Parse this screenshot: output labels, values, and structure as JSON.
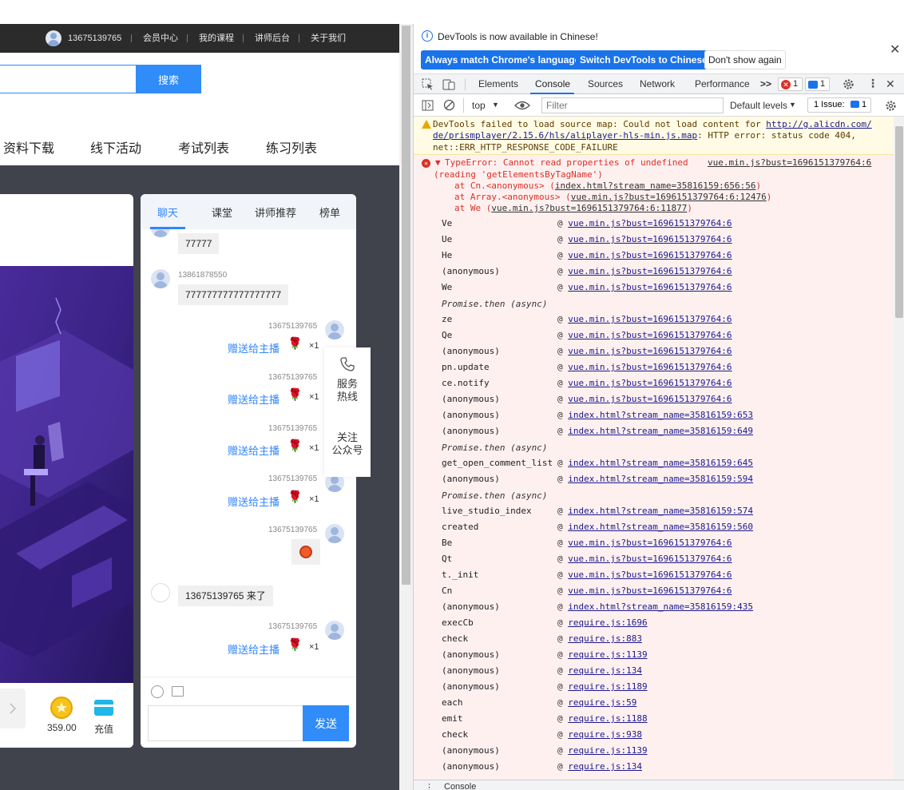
{
  "site": {
    "topbar": {
      "username": "13675139765",
      "links": [
        "会员中心",
        "我的课程",
        "讲师后台",
        "关于我们"
      ]
    },
    "search": {
      "placeholder": "",
      "button": "搜索"
    },
    "nav": [
      "资料下载",
      "线下活动",
      "考试列表",
      "练习列表"
    ],
    "player": {
      "coin_value": "359.00",
      "recharge": "充值"
    },
    "chat": {
      "tabs": [
        "聊天",
        "课堂",
        "讲师推荐",
        "榜单"
      ],
      "messages": [
        {
          "type": "text-left",
          "text": "77777"
        },
        {
          "type": "text-left",
          "user": "13861878550",
          "text": "777777777777777777"
        },
        {
          "type": "gift",
          "user": "13675139765",
          "gift": "赠送给主播",
          "count": "×1"
        },
        {
          "type": "gift",
          "user": "13675139765",
          "gift": "赠送给主播",
          "count": "×1"
        },
        {
          "type": "gift",
          "user": "13675139765",
          "gift": "赠送给主播",
          "count": "×1"
        },
        {
          "type": "gift",
          "user": "13675139765",
          "gift": "赠送给主播",
          "count": "×1"
        },
        {
          "type": "emoji",
          "user": "13675139765"
        },
        {
          "type": "join",
          "text": "13675139765 来了"
        },
        {
          "type": "gift",
          "user": "13675139765",
          "gift": "赠送给主播",
          "count": "×1"
        }
      ],
      "send": "发送"
    },
    "float": {
      "hotline_1": "服务",
      "hotline_2": "热线",
      "follow_1": "关注",
      "follow_2": "公众号"
    }
  },
  "devtools": {
    "notice": {
      "message": "DevTools is now available in Chinese!",
      "btn_match": "Always match Chrome's language",
      "btn_switch": "Switch DevTools to Chinese",
      "btn_dont": "Don't show again"
    },
    "tabs": [
      "Elements",
      "Console",
      "Sources",
      "Network",
      "Performance"
    ],
    "active_tab": "Console",
    "more": ">>",
    "error_count": "1",
    "message_count": "1",
    "toolbar": {
      "context": "top",
      "filter_placeholder": "Filter",
      "levels": "Default levels",
      "issues_label": "1 Issue:",
      "issues_count": "1"
    },
    "warning": {
      "line1_text": "DevTools failed to load source map: Could not load content for ",
      "line1_link": "http://g.alicdn.com/",
      "line2_link": "de/prismplayer/2.15.6/hls/aliplayer-hls-min.js.map",
      "line2_text": ": HTTP error: status code 404,",
      "line3": "net::ERR_HTTP_RESPONSE_CODE_FAILURE"
    },
    "error": {
      "line1": "TypeError: Cannot read properties of undefined",
      "source": "vue.min.js?bust=1696151379764:6",
      "line2": "(reading 'getElementsByTagName')",
      "at1_prefix": "at Cn.<anonymous> (",
      "at1_link": "index.html?stream_name=35816159:656:56",
      "at2_prefix": "at Array.<anonymous> (",
      "at2_link": "vue.min.js?bust=1696151379764:6:12476",
      "at3_prefix": "at We (",
      "at3_link": "vue.min.js?bust=1696151379764:6:11877",
      "promise_label": "Promise.then (async)",
      "frames": [
        {
          "fn": "Ve",
          "src": "vue.min.js?bust=1696151379764:6"
        },
        {
          "fn": "Ue",
          "src": "vue.min.js?bust=1696151379764:6"
        },
        {
          "fn": "He",
          "src": "vue.min.js?bust=1696151379764:6"
        },
        {
          "fn": "(anonymous)",
          "src": "vue.min.js?bust=1696151379764:6"
        },
        {
          "fn": "We",
          "src": "vue.min.js?bust=1696151379764:6"
        },
        {
          "promise": true
        },
        {
          "fn": "ze",
          "src": "vue.min.js?bust=1696151379764:6"
        },
        {
          "fn": "Qe",
          "src": "vue.min.js?bust=1696151379764:6"
        },
        {
          "fn": "(anonymous)",
          "src": "vue.min.js?bust=1696151379764:6"
        },
        {
          "fn": "pn.update",
          "src": "vue.min.js?bust=1696151379764:6"
        },
        {
          "fn": "ce.notify",
          "src": "vue.min.js?bust=1696151379764:6"
        },
        {
          "fn": "(anonymous)",
          "src": "vue.min.js?bust=1696151379764:6"
        },
        {
          "fn": "(anonymous)",
          "src": "index.html?stream_name=35816159:653"
        },
        {
          "fn": "(anonymous)",
          "src": "index.html?stream_name=35816159:649"
        },
        {
          "promise": true
        },
        {
          "fn": "get_open_comment_list",
          "src": "index.html?stream_name=35816159:645"
        },
        {
          "fn": "(anonymous)",
          "src": "index.html?stream_name=35816159:594"
        },
        {
          "promise": true
        },
        {
          "fn": "live_studio_index",
          "src": "index.html?stream_name=35816159:574"
        },
        {
          "fn": "created",
          "src": "index.html?stream_name=35816159:560"
        },
        {
          "fn": "Be",
          "src": "vue.min.js?bust=1696151379764:6"
        },
        {
          "fn": "Qt",
          "src": "vue.min.js?bust=1696151379764:6"
        },
        {
          "fn": "t._init",
          "src": "vue.min.js?bust=1696151379764:6"
        },
        {
          "fn": "Cn",
          "src": "vue.min.js?bust=1696151379764:6"
        },
        {
          "fn": "(anonymous)",
          "src": "index.html?stream_name=35816159:435"
        },
        {
          "fn": "execCb",
          "src": "require.js:1696"
        },
        {
          "fn": "check",
          "src": "require.js:883"
        },
        {
          "fn": "(anonymous)",
          "src": "require.js:1139"
        },
        {
          "fn": "(anonymous)",
          "src": "require.js:134"
        },
        {
          "fn": "(anonymous)",
          "src": "require.js:1189"
        },
        {
          "fn": "each",
          "src": "require.js:59"
        },
        {
          "fn": "emit",
          "src": "require.js:1188"
        },
        {
          "fn": "check",
          "src": "require.js:938"
        },
        {
          "fn": "(anonymous)",
          "src": "require.js:1139"
        },
        {
          "fn": "(anonymous)",
          "src": "require.js:134"
        }
      ]
    },
    "drawer_tab": "Console"
  }
}
